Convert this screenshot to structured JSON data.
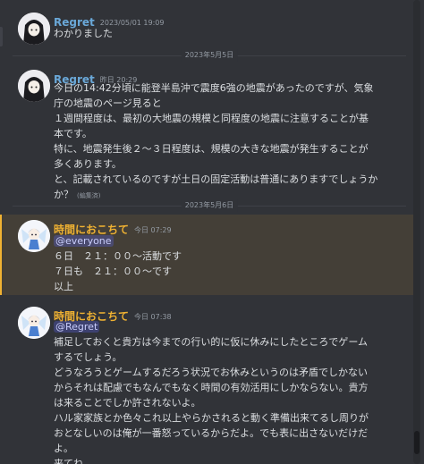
{
  "colors": {
    "background": "#313338",
    "regret_name": "#6aa8d8",
    "koch_name": "#f0b232",
    "mention_bg": "#3c4270"
  },
  "messages": [
    {
      "author": "Regret",
      "timestamp": "2023/05/01 19:09",
      "lines": [
        "わかりました"
      ]
    },
    {
      "author": "Regret",
      "timestamp": "昨日 20:29",
      "lines": [
        "今日の14:42分頃に能登半島沖で震度6強の地震があったのですが、気象",
        "庁の地震のページ見ると",
        "１週間程度は、最初の大地震の規模と同程度の地震に注意することが基",
        "本です。",
        "特に、地震発生後２～３日程度は、規模の大きな地震が発生することが",
        "多くあります。",
        "と、記載されているのですが土日の固定活動は普通にありますでしょうか",
        "か？"
      ],
      "edited": "(編集済)"
    },
    {
      "author": "時間におこちて",
      "timestamp": "今日 07:29",
      "mention": "@everyone",
      "lines": [
        "６日　２１：００～活動です",
        "７日も　２１：００～です",
        "以上"
      ]
    },
    {
      "author": "時間におこちて",
      "timestamp": "今日 07:38",
      "mention": "@Regret",
      "lines": [
        "補足しておくと貴方は今までの行い的に仮に休みにしたところでゲーム",
        "するでしょう。",
        "どうなろうとゲームするだろう状況でお休みというのは矛盾でしかない",
        "からそれは配慮でもなんでもなく時間の有効活用にしかならない。貴方",
        "は来ることでしか許されないよ。",
        "ハル家家族とか色々これ以上やらかされると動く準備出来てるし周りが",
        "おとなしいのは俺が一番怒っているからだよ。でも表に出さないだけだ",
        "よ。",
        "来てね。"
      ]
    }
  ],
  "dividers": [
    "2023年5月5日",
    "2023年5月6日"
  ]
}
